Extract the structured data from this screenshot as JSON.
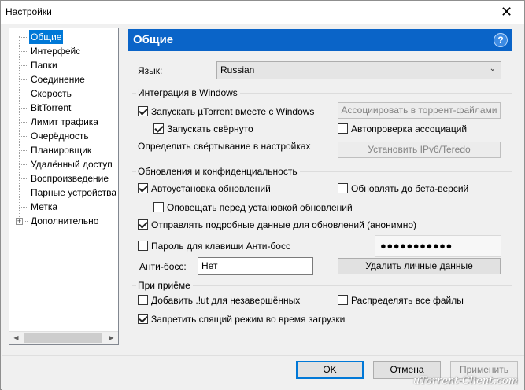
{
  "window": {
    "title": "Настройки",
    "close_glyph": "✕"
  },
  "tree": {
    "items": [
      {
        "label": "Общие",
        "selected": true
      },
      {
        "label": "Интерфейс"
      },
      {
        "label": "Папки"
      },
      {
        "label": "Соединение"
      },
      {
        "label": "Скорость"
      },
      {
        "label": "BitTorrent"
      },
      {
        "label": "Лимит трафика"
      },
      {
        "label": "Очерёдность"
      },
      {
        "label": "Планировщик"
      },
      {
        "label": "Удалённый доступ"
      },
      {
        "label": "Воспроизведение"
      },
      {
        "label": "Парные устройства"
      },
      {
        "label": "Метка"
      },
      {
        "label": "Дополнительно",
        "expandable": true
      }
    ],
    "expander_glyph": "+",
    "scroll_left": "◀",
    "scroll_right": "▶"
  },
  "header": {
    "title": "Общие",
    "help_glyph": "?"
  },
  "language": {
    "label": "Язык:",
    "value": "Russian",
    "arrow": "⌄"
  },
  "windows_group": {
    "title": "Интеграция в Windows",
    "start_with_windows": "Запускать µTorrent вместе с Windows",
    "start_minimized": "Запускать свёрнуто",
    "minimize_setting": "Определить свёртывание в настройках",
    "associate_button": "Ассоциировать в торрент-файлами",
    "autocheck": "Автопроверка ассоциаций",
    "ipv6_button": "Установить IPv6/Teredo"
  },
  "updates_group": {
    "title": "Обновления и конфиденциальность",
    "auto_update": "Автоустановка обновлений",
    "beta": "Обновлять до бета-версий",
    "notify_before": "Оповещать перед установкой обновлений",
    "send_data": "Отправлять подробные данные для обновлений (анонимно)",
    "boss_password": "Пароль для клавиши Анти-босс",
    "password_mask": "●●●●●●●●●●●",
    "boss_key_label": "Анти-босс:",
    "boss_key_value": "Нет",
    "delete_data_button": "Удалить личные данные"
  },
  "download_group": {
    "title": "При приёме",
    "add_ut": "Добавить .!ut для незавершённых",
    "distribute": "Распределять все файлы",
    "prevent_sleep": "Запретить спящий режим во время загрузки"
  },
  "buttons": {
    "ok": "OK",
    "cancel": "Отмена",
    "apply": "Применить"
  },
  "watermark": "uTorrent-Client.com"
}
